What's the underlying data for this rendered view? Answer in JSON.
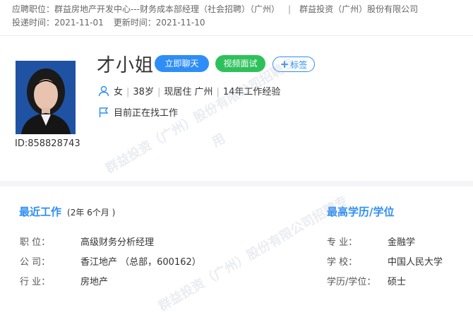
{
  "header": {
    "position_label": "应聘职位：",
    "position_value": "群益房地产开发中心---财务成本部经理（社会招聘）（广州）",
    "company": "群益投资（广州）股份有限公司",
    "delivery_label": "投递时间：",
    "delivery_date": "2021-11-01",
    "update_label": "更新时间：",
    "update_date": "2021-11-10"
  },
  "profile": {
    "name": "才小姐",
    "id_text": "ID:858828743",
    "chat_button": "立即聊天",
    "video_button": "视频面试",
    "tag_button": "标签",
    "gender": "女",
    "age": "38岁",
    "residence": "现居住 广州",
    "experience": "14年工作经验",
    "job_status": "目前正在找工作"
  },
  "recent_work": {
    "title": "最近工作",
    "duration": "(2年 6个月 )",
    "rows": [
      {
        "label": "职    位：",
        "value": "高级财务分析经理"
      },
      {
        "label": "公    司：",
        "value": "香江地产 （总部，600162）"
      },
      {
        "label": "行    业：",
        "value": "房地产"
      }
    ]
  },
  "education": {
    "title": "最高学历/学位",
    "rows": [
      {
        "label": "专    业：",
        "value": "金融学"
      },
      {
        "label": "学    校：",
        "value": "中国人民大学"
      },
      {
        "label": "学历/学位：",
        "value": "硕士"
      }
    ]
  },
  "watermark": {
    "line1": "群益投资（广州）股份有限公司招聘专",
    "line2": "用"
  },
  "colors": {
    "accent": "#2f8ef5",
    "video": "#2ec15b"
  }
}
